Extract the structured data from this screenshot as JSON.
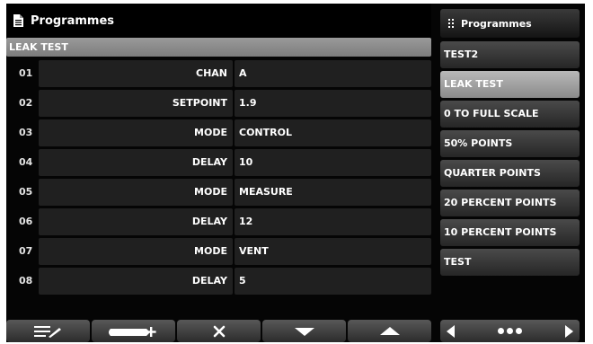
{
  "header": {
    "title": "Programmes",
    "icon": "document-icon"
  },
  "program_name": "LEAK TEST",
  "steps": [
    {
      "num": "01",
      "command": "CHAN",
      "value": "A"
    },
    {
      "num": "02",
      "command": "SETPOINT",
      "value": "1.9"
    },
    {
      "num": "03",
      "command": "MODE",
      "value": "CONTROL"
    },
    {
      "num": "04",
      "command": "DELAY",
      "value": "10"
    },
    {
      "num": "05",
      "command": "MODE",
      "value": "MEASURE"
    },
    {
      "num": "06",
      "command": "DELAY",
      "value": "12"
    },
    {
      "num": "07",
      "command": "MODE",
      "value": "VENT"
    },
    {
      "num": "08",
      "command": "DELAY",
      "value": "5"
    }
  ],
  "toolbar": {
    "buttons": [
      "edit-icon",
      "insert-step-icon",
      "delete-icon",
      "move-down-icon",
      "move-up-icon"
    ]
  },
  "sidebar": {
    "title": "Programmes",
    "icon": "grid-menu-icon",
    "items": [
      {
        "label": "TEST2"
      },
      {
        "label": "LEAK TEST",
        "selected": true
      },
      {
        "label": "0 TO FULL SCALE"
      },
      {
        "label": "50% POINTS"
      },
      {
        "label": "QUARTER POINTS"
      },
      {
        "label": "20 PERCENT POINTS"
      },
      {
        "label": "10 PERCENT POINTS"
      },
      {
        "label": "TEST"
      }
    ]
  },
  "colors": {
    "background": "#050505",
    "cell": "#202020",
    "selected": "#a0a0a0"
  }
}
